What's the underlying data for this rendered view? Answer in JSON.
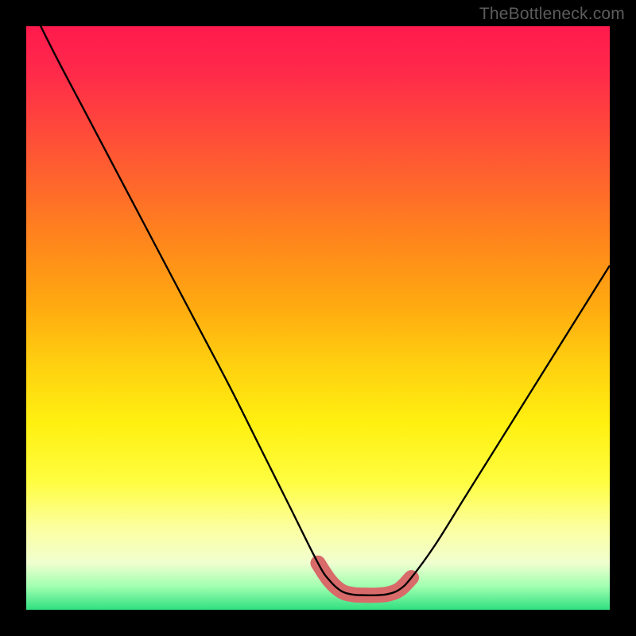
{
  "watermark": {
    "text": "TheBottleneck.com"
  },
  "colors": {
    "page_bg": "#000000",
    "curve": "#000000",
    "marker": "#d86a6a",
    "watermark": "#5c5c5c",
    "gradient_stops": [
      "#ff1a4d",
      "#ff2a4a",
      "#ff4a3a",
      "#ff6a2a",
      "#ff8a1a",
      "#ffaa10",
      "#ffd010",
      "#fff010",
      "#fffd40",
      "#fcffa0",
      "#f0ffd0",
      "#a0ffb0",
      "#30e080"
    ]
  },
  "chart_data": {
    "type": "line",
    "title": "",
    "xlabel": "",
    "ylabel": "",
    "xlim": [
      0,
      100
    ],
    "ylim": [
      0,
      100
    ],
    "annotations": [],
    "series": [
      {
        "name": "bottleneck-curve",
        "x": [
          0,
          5,
          10,
          15,
          20,
          25,
          30,
          35,
          40,
          45,
          50,
          52,
          54,
          56,
          58,
          60,
          62,
          64,
          66,
          70,
          75,
          80,
          85,
          90,
          95,
          100
        ],
        "y": [
          105,
          95,
          85.5,
          76,
          66.5,
          57,
          47.5,
          38,
          28,
          18,
          8,
          5,
          3.2,
          2.6,
          2.5,
          2.5,
          2.7,
          3.5,
          5.5,
          11,
          19,
          27,
          35,
          43,
          51,
          59
        ]
      },
      {
        "name": "optimal-range-marker",
        "x": [
          50,
          52,
          54,
          56,
          58,
          60,
          62,
          64,
          66
        ],
        "y": [
          8,
          5,
          3.2,
          2.6,
          2.5,
          2.5,
          2.7,
          3.5,
          5.5
        ]
      }
    ]
  }
}
